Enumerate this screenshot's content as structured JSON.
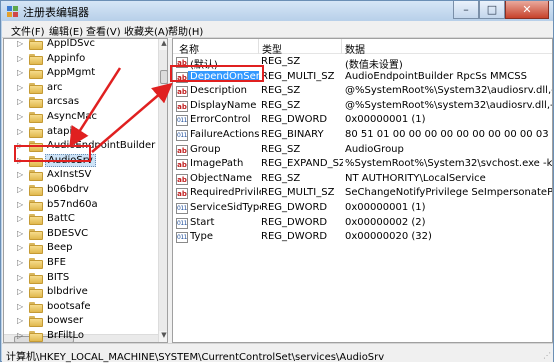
{
  "window": {
    "title": "注册表编辑器",
    "controls": {
      "minimize": "–",
      "maximize": "□",
      "close": "✕"
    }
  },
  "menu": [
    "文件(F)",
    "编辑(E)",
    "查看(V)",
    "收藏夹(A)",
    "帮助(H)"
  ],
  "tree": {
    "items": [
      "AppIDSvc",
      "Appinfo",
      "AppMgmt",
      "arc",
      "arcsas",
      "AsyncMac",
      "atapi",
      "AudioEndpointBuilder",
      "AudioSrv",
      "AxInstSV",
      "b06bdrv",
      "b57nd60a",
      "BattC",
      "BDESVC",
      "Beep",
      "BFE",
      "BITS",
      "blbdrive",
      "bootsafe",
      "bowser",
      "BrFiltLo"
    ],
    "selected_index": 8
  },
  "columns": [
    "名称",
    "类型",
    "数据"
  ],
  "values": [
    {
      "name": "(默认)",
      "type": "REG_SZ",
      "data": "(数值未设置)",
      "icon": "ab"
    },
    {
      "name": "DependOnSer...",
      "type": "REG_MULTI_SZ",
      "data": "AudioEndpointBuilder RpcSs MMCSS",
      "icon": "ab"
    },
    {
      "name": "Description",
      "type": "REG_SZ",
      "data": "@%SystemRoot%\\System32\\audiosrv.dll,-201",
      "icon": "ab"
    },
    {
      "name": "DisplayName",
      "type": "REG_SZ",
      "data": "@%SystemRoot%\\system32\\audiosrv.dll,-200",
      "icon": "ab"
    },
    {
      "name": "ErrorControl",
      "type": "REG_DWORD",
      "data": "0x00000001 (1)",
      "icon": "bin"
    },
    {
      "name": "FailureActions",
      "type": "REG_BINARY",
      "data": "80 51 01 00 00 00 00 00 00 00 00 00 03 00 00...",
      "icon": "bin"
    },
    {
      "name": "Group",
      "type": "REG_SZ",
      "data": "AudioGroup",
      "icon": "ab"
    },
    {
      "name": "ImagePath",
      "type": "REG_EXPAND_SZ",
      "data": "%SystemRoot%\\System32\\svchost.exe -k Loc...",
      "icon": "ab"
    },
    {
      "name": "ObjectName",
      "type": "REG_SZ",
      "data": "NT AUTHORITY\\LocalService",
      "icon": "ab"
    },
    {
      "name": "RequiredPrivile...",
      "type": "REG_MULTI_SZ",
      "data": "SeChangeNotifyPrivilege SeImpersonatePrivil...",
      "icon": "ab"
    },
    {
      "name": "ServiceSidType",
      "type": "REG_DWORD",
      "data": "0x00000001 (1)",
      "icon": "bin"
    },
    {
      "name": "Start",
      "type": "REG_DWORD",
      "data": "0x00000002 (2)",
      "icon": "bin"
    },
    {
      "name": "Type",
      "type": "REG_DWORD",
      "data": "0x00000020 (32)",
      "icon": "bin"
    }
  ],
  "selected_value_index": 1,
  "icon_glyphs": {
    "ab": "ab",
    "bin": "011"
  },
  "status": "计算机\\HKEY_LOCAL_MACHINE\\SYSTEM\\CurrentControlSet\\services\\AudioSrv",
  "colors": {
    "annotation": "#e02020",
    "selection": "#3399ff"
  }
}
